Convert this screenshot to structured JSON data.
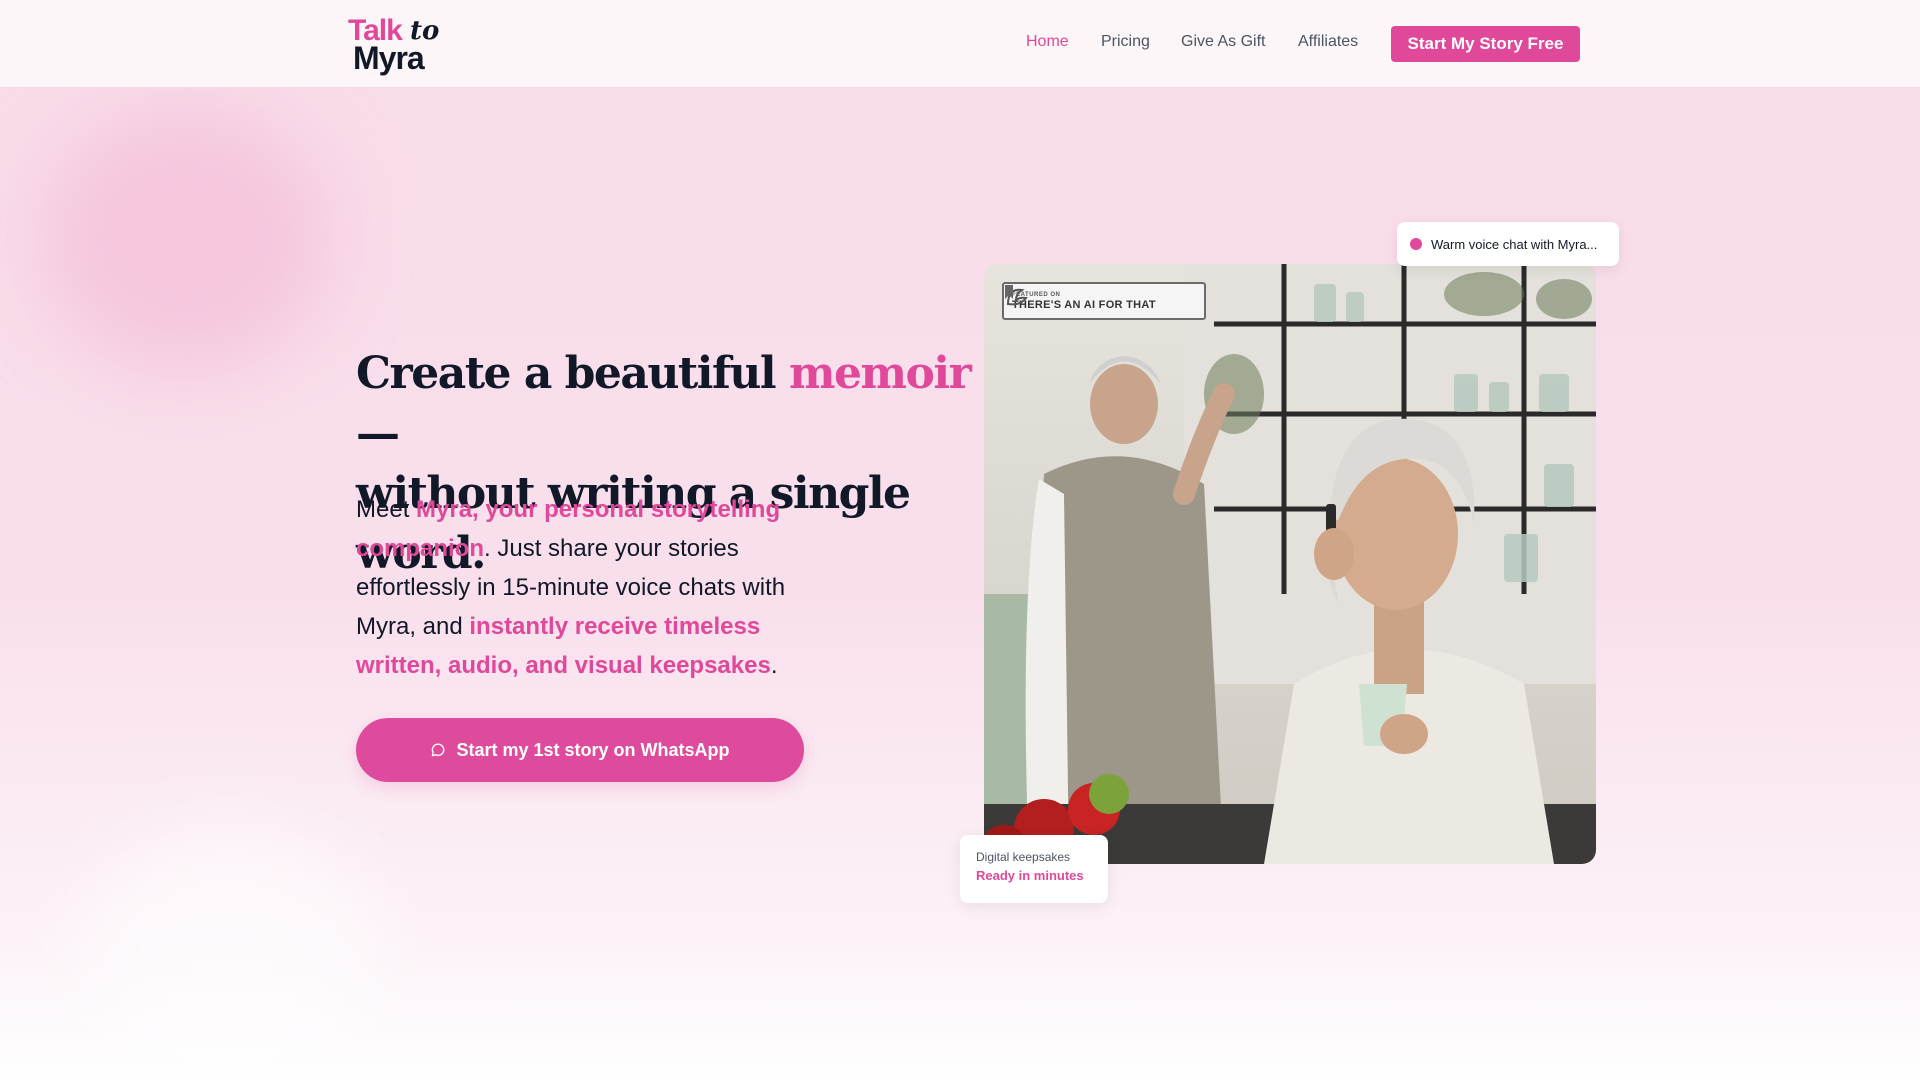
{
  "header": {
    "logo": {
      "line1": "Talk",
      "line1_suffix": "to",
      "line2": "Myra"
    },
    "nav": [
      {
        "label": "Home",
        "active": true
      },
      {
        "label": "Pricing",
        "active": false
      },
      {
        "label": "Give As Gift",
        "active": false
      },
      {
        "label": "Affiliates",
        "active": false
      }
    ],
    "cta_label": "Start My Story Free"
  },
  "hero": {
    "title_part1": "Create a beautiful",
    "title_accent": "memoir",
    "title_part2": " —",
    "title_line2": "without writing a single word.",
    "body": {
      "t1": "Meet ",
      "h1": "Myra, your personal storytelling companion",
      "t2": ". Just share your stories effortlessly in 15-minute voice chats with Myra, and ",
      "h2": "instantly receive timeless written, audio, and visual keepsakes",
      "t3": "."
    },
    "cta_label": "Start my 1st story on WhatsApp",
    "cta_icon": "chat-bubble-icon"
  },
  "photo": {
    "badge": {
      "small": "FEATURED ON",
      "big": "THERE'S AN AI FOR THAT"
    }
  },
  "floating": {
    "voice_chat": "Warm voice chat with Myra...",
    "keepsake_label": "Digital keepsakes",
    "keepsake_value": "Ready in minutes"
  },
  "colors": {
    "accent": "#e0489a",
    "text": "#111827",
    "muted": "#4b5563"
  }
}
